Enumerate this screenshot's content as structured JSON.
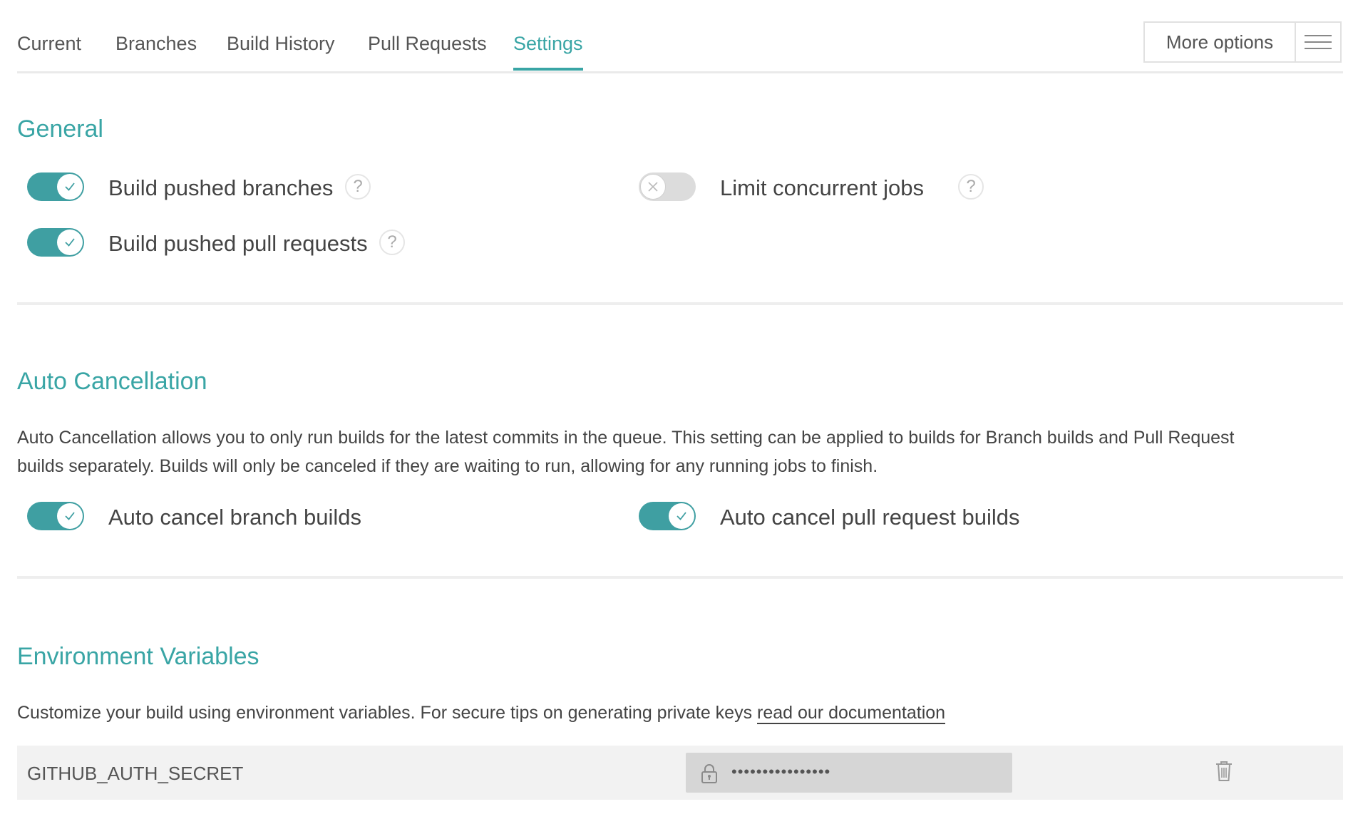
{
  "tabs": [
    {
      "label": "Current"
    },
    {
      "label": "Branches"
    },
    {
      "label": "Build History"
    },
    {
      "label": "Pull Requests"
    },
    {
      "label": "Settings",
      "active": true
    }
  ],
  "more_options": {
    "label": "More options",
    "icon": "hamburger-menu-icon"
  },
  "general": {
    "title": "General",
    "build_pushed_branches": {
      "label": "Build pushed branches",
      "enabled": true,
      "help": "?"
    },
    "build_pushed_pull_requests": {
      "label": "Build pushed pull requests",
      "enabled": true,
      "help": "?"
    },
    "limit_concurrent_jobs": {
      "label": "Limit concurrent jobs",
      "enabled": false,
      "help": "?"
    }
  },
  "auto_cancellation": {
    "title": "Auto Cancellation",
    "description_line1": "Auto Cancellation allows you to only run builds for the latest commits in the queue. This setting can be applied to builds for Branch builds and Pull Request",
    "description_line2": "builds separately. Builds will only be canceled if they are waiting to run, allowing for any running jobs to finish.",
    "branch_builds": {
      "label": "Auto cancel branch builds",
      "enabled": true
    },
    "pull_request_builds": {
      "label": "Auto cancel pull request builds",
      "enabled": true
    }
  },
  "environment_variables": {
    "title": "Environment Variables",
    "description": "Customize your build using environment variables. For secure tips on generating private keys ",
    "doc_link": "read our documentation",
    "variables": [
      {
        "name": "GITHUB_AUTH_SECRET",
        "value_masked": "••••••••••••••••",
        "icon": "lock-icon",
        "delete_icon": "trash-icon"
      }
    ]
  },
  "colors": {
    "accent": "#39a5a5",
    "toggle_on": "#3f9fa2",
    "toggle_off": "#dcdcdc"
  }
}
